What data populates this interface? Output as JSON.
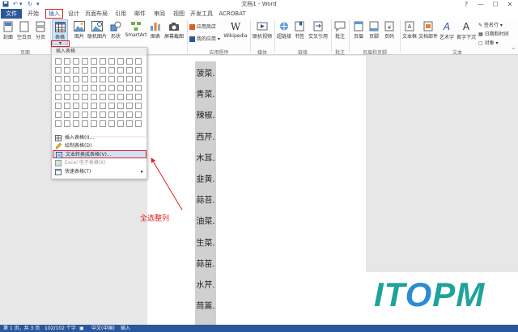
{
  "window": {
    "title": "文档1 - Word",
    "controls": [
      "?",
      "—",
      "☐",
      "✕"
    ]
  },
  "tabs": [
    "文件",
    "开始",
    "插入",
    "设计",
    "页面布局",
    "引用",
    "邮件",
    "审阅",
    "视图",
    "开发工具",
    "ACROBAT"
  ],
  "ribbon": {
    "buttons": {
      "cover": "封面",
      "blank": "空白页",
      "pagebreak": "分页",
      "table": "表格",
      "picture": "图片",
      "online_picture": "联机图片",
      "shapes": "形状",
      "smartart": "SmartArt",
      "chart": "图表",
      "screenshot": "屏幕截图",
      "app_store": "应用商店",
      "my_apps": "我的应用",
      "wikipedia": "Wikipedia",
      "online_video": "联机视频",
      "hyperlink": "超链接",
      "bookmark": "书签",
      "crossref": "交叉引用",
      "comment": "批注",
      "header": "页眉",
      "footer": "页脚",
      "page_number": "页码",
      "textbox": "文本框",
      "quickparts": "文档部件",
      "wordart": "艺术字",
      "dropcap": "首字下沉",
      "signature": "签名行",
      "datetime": "日期和时间",
      "object": "对象"
    },
    "groups": {
      "pages": "页面",
      "apps": "应用程序",
      "media": "媒体",
      "links": "链接",
      "comments": "批注",
      "header_footer": "页眉和页脚",
      "text": "文本"
    }
  },
  "dropdown": {
    "header": "插入表格",
    "items": [
      {
        "label": "插入表格(I)...",
        "disabled": false
      },
      {
        "label": "绘制表格(D)",
        "disabled": false
      },
      {
        "label": "文本转换成表格(V)...",
        "disabled": false
      },
      {
        "label": "Excel 电子表格(X)",
        "disabled": true
      },
      {
        "label": "快速表格(T)",
        "disabled": false
      }
    ]
  },
  "document": {
    "lines": [
      "菠菜.",
      "青菜.",
      "辣椒.",
      "西芹.",
      "木耳.",
      "韭黄.",
      "蒜苔.",
      "油菜.",
      "生菜.",
      "蒜苗.",
      "水芹.",
      "茼蒿."
    ]
  },
  "annotation": "全选整列",
  "status": {
    "page": "第 1 页，共 3 页",
    "words": "102/102 个字",
    "language": "中文(中国)",
    "mode": "插入"
  },
  "logo": {
    "prefix": "IT",
    "o": "O",
    "suffix": "PM"
  },
  "colors": {
    "accent": "#2b579a",
    "highlight": "#cfe2f8",
    "annotation": "#e02020",
    "logo_teal": "#1ea39a",
    "logo_blue": "#2a8bd6"
  }
}
